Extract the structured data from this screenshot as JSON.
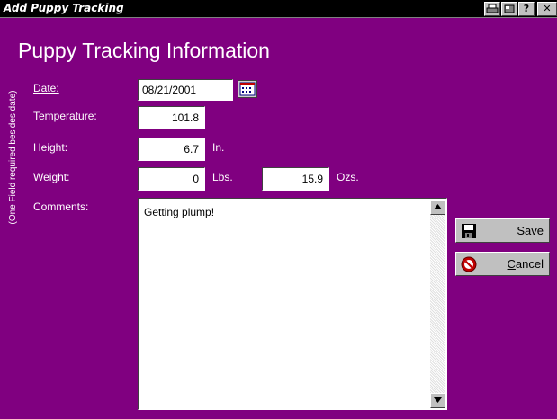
{
  "window": {
    "title": "Add Puppy Tracking",
    "buttons": {
      "print_label": "",
      "help_label": "?",
      "close_label": "✕"
    }
  },
  "form": {
    "heading": "Puppy Tracking Information",
    "side_note": "(One Field required besides date)",
    "date": {
      "label": "Date:",
      "value": "08/21/2001"
    },
    "temperature": {
      "label": "Temperature:",
      "value": "101.8"
    },
    "height": {
      "label": "Height:",
      "value": "6.7",
      "unit": "In."
    },
    "weight": {
      "label": "Weight:",
      "lbs_value": "0",
      "lbs_unit": "Lbs.",
      "ozs_value": "15.9",
      "ozs_unit": "Ozs."
    },
    "comments": {
      "label": "Comments:",
      "value": "Getting plump!"
    }
  },
  "actions": {
    "save": {
      "mnemonic": "S",
      "rest": "ave"
    },
    "cancel": {
      "mnemonic": "C",
      "rest": "ancel"
    }
  },
  "colors": {
    "background": "#800080",
    "title_bar": "#000000",
    "button_face": "#c0c0c0",
    "field": "#ffffff"
  },
  "icons": [
    "calendar-icon",
    "floppy-disk-icon",
    "cancel-circle-icon",
    "print-icon",
    "scroll-up-arrow-icon",
    "scroll-down-arrow-icon"
  ]
}
